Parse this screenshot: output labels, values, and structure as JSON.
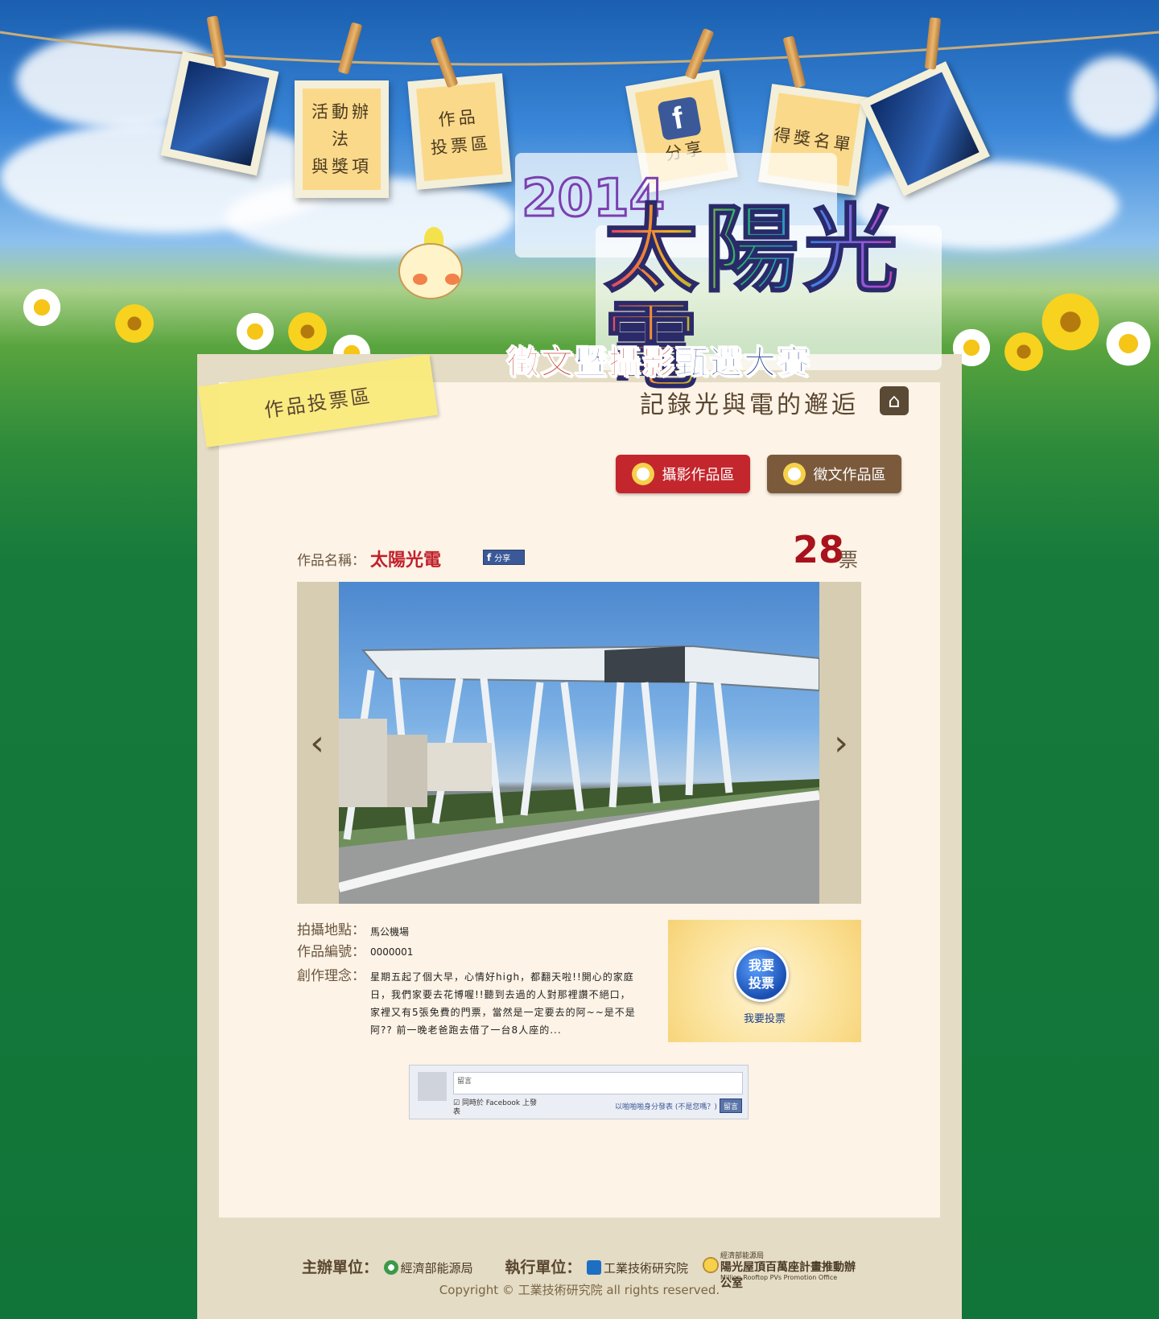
{
  "nav": {
    "rules": "活動辦法\n與獎項",
    "vote_zone": "作品\n投票區",
    "share": "分享",
    "winners": "得獎名單"
  },
  "logo": {
    "year": "2014",
    "main": "太陽光電",
    "sub_a": "徵文",
    "sub_b": "暨",
    "sub_c": "攝影",
    "sub_d": "甄選大賽"
  },
  "section_label": "作品投票區",
  "tagline": "記錄光與電的邂逅",
  "tabs": {
    "photo": "攝影作品區",
    "essay": "徵文作品區"
  },
  "work": {
    "name_label": "作品名稱：",
    "name": "太陽光電",
    "share": "分享",
    "votes": "28",
    "votes_unit": "票",
    "location_label": "拍攝地點：",
    "location": "馬公機場",
    "number_label": "作品編號：",
    "number": "0000001",
    "concept_label": "創作理念：",
    "concept": "星期五起了個大早，心情好high，都翻天啦!!開心的家庭日，我們家要去花博喔!!聽到去過的人對那裡讚不絕口，家裡又有5張免費的門票，當然是一定要去的阿~~是不是阿?? 前一晚老爸跑去借了一台8人座的..."
  },
  "vote": {
    "button": "我要\n投票",
    "link": "我要投票"
  },
  "comments": {
    "placeholder": "留言",
    "also_post": "同時於 Facebook 上發表",
    "posting_as": "以啪啪啪身分發表 (不是您嗎？)",
    "submit": "留言"
  },
  "footer": {
    "organizer_label": "主辦單位：",
    "organizer": "經濟部能源局",
    "executor_label": "執行單位：",
    "executor": "工業技術研究院",
    "partner_line1": "經濟部能源局",
    "partner_line2": "陽光屋頂百萬座計畫推動辦公室",
    "partner_line3": "Million Rooftop PVs Promotion Office",
    "copyright": "Copyright © 工業技術研究院 all rights reserved."
  },
  "colors": {
    "accent_red": "#c4262d",
    "accent_brown": "#7b5a3c",
    "panel": "#e4dcc4",
    "panel_inner": "#fdf3e6"
  }
}
